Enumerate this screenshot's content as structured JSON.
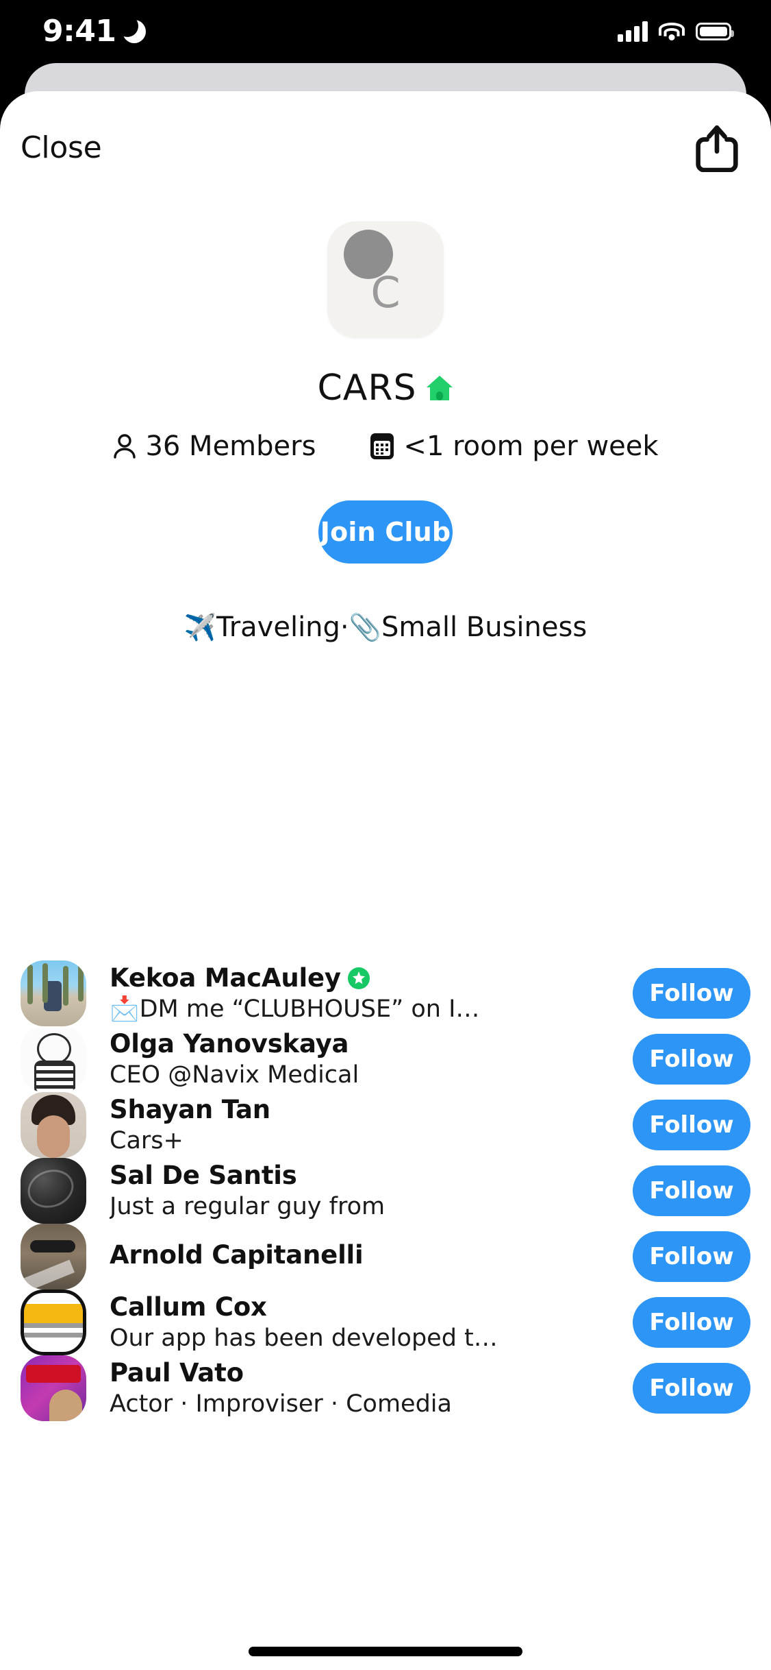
{
  "status_bar": {
    "time": "9:41",
    "dnd_icon": "crescent-moon-icon",
    "signal_icon": "cellular-signal-icon",
    "wifi_icon": "wifi-icon",
    "battery_icon": "battery-icon"
  },
  "modal": {
    "close_label": "Close",
    "share_icon": "share-icon"
  },
  "club": {
    "avatar_letter": "C",
    "name": "CARS",
    "name_emoji": "🏠",
    "members_text": "36 Members",
    "members_icon": "person-icon",
    "frequency_text": "<1 room per week",
    "frequency_icon": "calendar-icon",
    "join_label": "Join Club",
    "topics": [
      {
        "emoji": "✈️",
        "label": "Traveling"
      },
      {
        "emoji": "📎",
        "label": "Small Business"
      }
    ],
    "topic_separator": " · "
  },
  "follow_label": "Follow",
  "members": [
    {
      "name": "Kekoa MacAuley",
      "bio": "📩DM me “CLUBHOUSE” on I…",
      "badge": "green-sparkle-badge",
      "avatar": "av-palms",
      "follow": "Follow"
    },
    {
      "name": "Olga Yanovskaya",
      "bio": "CEO @Navix Medical",
      "badge": "",
      "avatar": "av-sketch",
      "follow": "Follow"
    },
    {
      "name": "Shayan Tan",
      "bio": "Cars+",
      "badge": "",
      "avatar": "av-shayan",
      "follow": "Follow"
    },
    {
      "name": "Sal De Santis",
      "bio": "Just a regular guy from",
      "badge": "",
      "avatar": "av-dark",
      "follow": "Follow"
    },
    {
      "name": "Arnold Capitanelli",
      "bio": "",
      "badge": "",
      "avatar": "av-arnold",
      "follow": "Follow"
    },
    {
      "name": "Callum Cox",
      "bio": "Our app has been developed t…",
      "badge": "",
      "avatar": "av-parking",
      "follow": "Follow"
    },
    {
      "name": "Paul Vato",
      "bio": "Actor · Improviser · Comedia",
      "badge": "",
      "avatar": "av-paul",
      "follow": "Follow"
    }
  ],
  "colors": {
    "accent_blue": "#2d95f5",
    "badge_green": "#17c964",
    "sheet_back": "#d9d9dd"
  }
}
